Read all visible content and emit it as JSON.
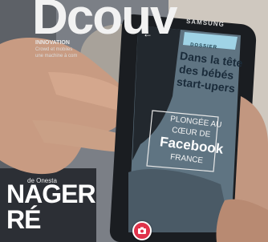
{
  "magazine": {
    "title": "Dcouv",
    "kicker": "INNOVATION",
    "sub1": "Crowd et mobiles",
    "sub2": "une machine à com",
    "author": "de Onesta",
    "headline1": "NAGER",
    "headline2": "RÉ"
  },
  "phone": {
    "brand": "SAMSUNG",
    "tag": "DOSSIER",
    "headline_lines": [
      "Dans la tête",
      "des bébés",
      "start-upers"
    ],
    "box_lines": [
      "PLONGÉE AU",
      "CŒUR DE",
      "Facebook",
      "FRANCE"
    ]
  },
  "colors": {
    "shutter": "#e0324a",
    "screen_bg": "#5f7482",
    "accent": "#9fd3e6"
  },
  "icons": [
    "back-arrow-icon",
    "camera-icon"
  ]
}
